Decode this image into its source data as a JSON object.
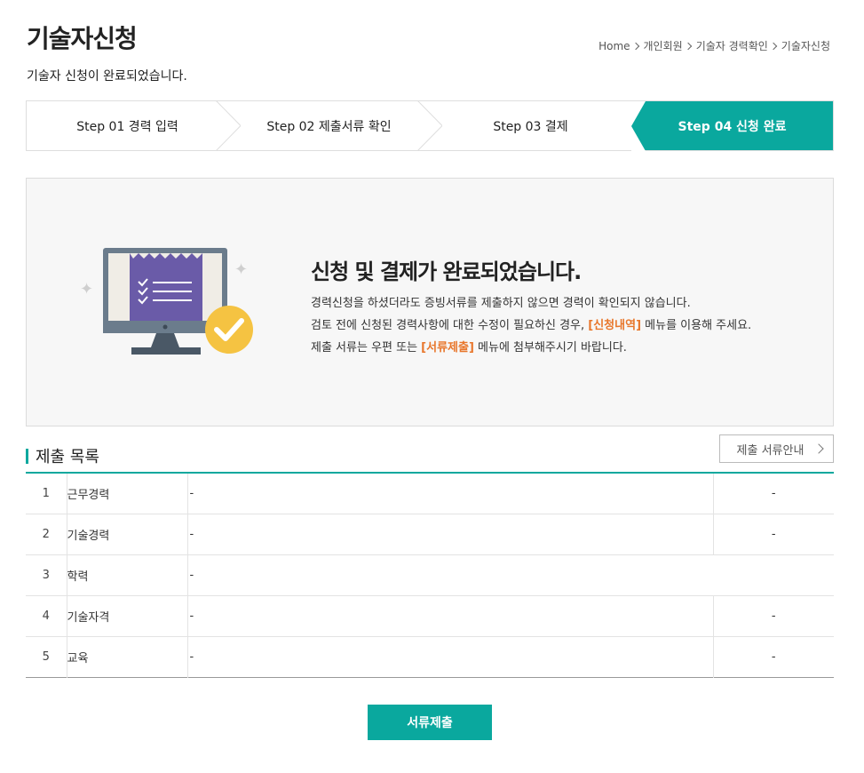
{
  "header": {
    "title": "기술자신청",
    "subtitle": "기술자 신청이 완료되었습니다."
  },
  "breadcrumb": [
    "Home",
    "개인회원",
    "기술자 경력확인",
    "기술자신청"
  ],
  "steps": [
    {
      "label": "Step 01 경력 입력",
      "active": false
    },
    {
      "label": "Step 02 제출서류 확인",
      "active": false
    },
    {
      "label": "Step 03 결제",
      "active": false
    },
    {
      "label": "Step 04 신청 완료",
      "active": true
    }
  ],
  "done": {
    "title": "신청 및 결제가 완료되었습니다.",
    "line1": "경력신청을 하셨더라도 증빙서류를 제출하지 않으면 경력이 확인되지 않습니다.",
    "line2_pre": "검토 전에 신청된 경력사항에 대한 수정이 필요하신 경우, ",
    "line2_hl": "[신청내역]",
    "line2_post": " 메뉴를 이용해 주세요.",
    "line3_pre": "제출 서류는 우편 또는 ",
    "line3_hl": "[서류제출]",
    "line3_post": " 메뉴에 첨부해주시기 바랍니다."
  },
  "section": {
    "title": "제출 목록",
    "guide_button": "제출 서류안내"
  },
  "rows": [
    {
      "no": "1",
      "name": "근무경력",
      "value": "-",
      "extra": "-"
    },
    {
      "no": "2",
      "name": "기술경력",
      "value": "-",
      "extra": "-"
    },
    {
      "no": "3",
      "name": "학력",
      "value": "-",
      "extra": ""
    },
    {
      "no": "4",
      "name": "기술자격",
      "value": "-",
      "extra": "-"
    },
    {
      "no": "5",
      "name": "교육",
      "value": "-",
      "extra": "-"
    }
  ],
  "submit_button": "서류제출",
  "colors": {
    "accent": "#0aa89e",
    "highlight": "#e8762b",
    "check": "#f5c342"
  }
}
